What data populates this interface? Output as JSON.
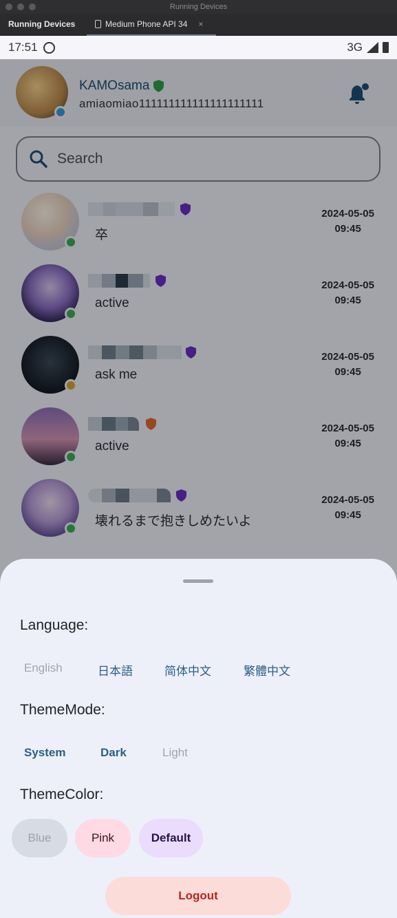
{
  "window": {
    "title": "Running Devices",
    "panel_title": "Running Devices",
    "device_tab": "Medium Phone API 34",
    "close_glyph": "×"
  },
  "statusbar": {
    "time": "17:51",
    "network": "3G"
  },
  "header": {
    "username": "KAMOsama",
    "user_id": "amiaomiao111111111111111111111",
    "verified_color": "#2e9e4a",
    "online_color": "#3b9ad9"
  },
  "search": {
    "placeholder": "Search"
  },
  "chats": [
    {
      "message": "卒",
      "date": "2024-05-05",
      "time": "09:45",
      "status_color": "#3cae52",
      "badge_color": "#6a2fc4"
    },
    {
      "message": "active",
      "date": "2024-05-05",
      "time": "09:45",
      "status_color": "#3cae52",
      "badge_color": "#6a2fc4"
    },
    {
      "message": "ask me",
      "date": "2024-05-05",
      "time": "09:45",
      "status_color": "#d6a531",
      "badge_color": "#6a2fc4"
    },
    {
      "message": "active",
      "date": "2024-05-05",
      "time": "09:45",
      "status_color": "#3cae52",
      "badge_color": "#e06b32"
    },
    {
      "message": "壊れるまで抱きしめたいよ",
      "date": "2024-05-05",
      "time": "09:45",
      "status_color": "#3cae52",
      "badge_color": "#6a2fc4"
    }
  ],
  "sheet": {
    "language_title": "Language:",
    "languages": [
      "English",
      "日本語",
      "简体中文",
      "繁體中文"
    ],
    "language_selected": "English",
    "theme_mode_title": "ThemeMode:",
    "theme_modes": [
      "System",
      "Dark",
      "Light"
    ],
    "theme_mode_selected": "Light",
    "theme_color_title": "ThemeColor:",
    "theme_colors": [
      "Blue",
      "Pink",
      "Default"
    ],
    "theme_color_selected": "Blue",
    "logout_label": "Logout"
  }
}
